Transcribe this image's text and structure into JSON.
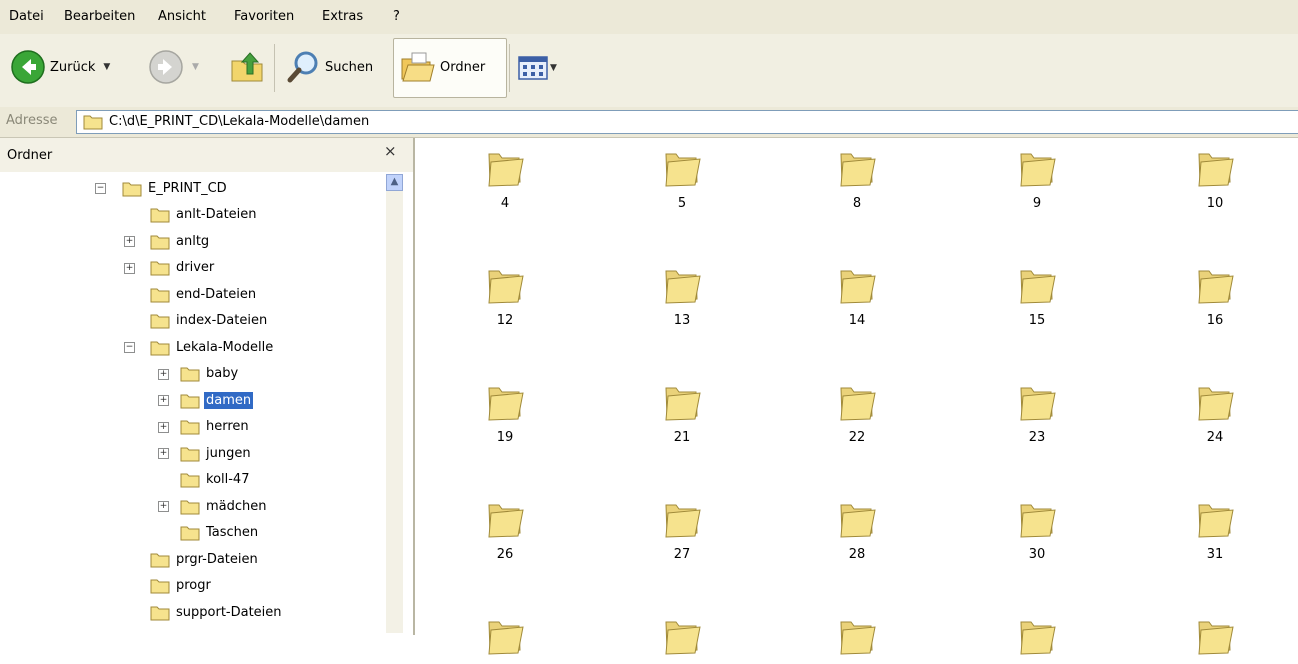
{
  "menu": [
    "Datei",
    "Bearbeiten",
    "Ansicht",
    "Favoriten",
    "Extras",
    "?"
  ],
  "toolbar": {
    "back_label": "Zurück",
    "search_label": "Suchen",
    "folders_label": "Ordner"
  },
  "address": {
    "label": "Adresse",
    "path": "C:\\d\\E_PRINT_CD\\Lekala-Modelle\\damen"
  },
  "folder_pane": {
    "title": "Ordner",
    "close": "×",
    "tree": [
      {
        "label": "E_PRINT_CD",
        "expander": "−",
        "level": 0
      },
      {
        "label": "anlt-Dateien",
        "expander": "",
        "level": 1
      },
      {
        "label": "anltg",
        "expander": "+",
        "level": 1
      },
      {
        "label": "driver",
        "expander": "+",
        "level": 1
      },
      {
        "label": "end-Dateien",
        "expander": "",
        "level": 1
      },
      {
        "label": "index-Dateien",
        "expander": "",
        "level": 1
      },
      {
        "label": "Lekala-Modelle",
        "expander": "−",
        "level": 1
      },
      {
        "label": "baby",
        "expander": "+",
        "level": 2
      },
      {
        "label": "damen",
        "expander": "+",
        "level": 2,
        "selected": true
      },
      {
        "label": "herren",
        "expander": "+",
        "level": 2
      },
      {
        "label": "jungen",
        "expander": "+",
        "level": 2
      },
      {
        "label": "koll-47",
        "expander": "",
        "level": 2
      },
      {
        "label": "mädchen",
        "expander": "+",
        "level": 2
      },
      {
        "label": "Taschen",
        "expander": "",
        "level": 2
      },
      {
        "label": "prgr-Dateien",
        "expander": "",
        "level": 1
      },
      {
        "label": "progr",
        "expander": "",
        "level": 1
      },
      {
        "label": "support-Dateien",
        "expander": "",
        "level": 1
      }
    ]
  },
  "folders": [
    "4",
    "5",
    "8",
    "9",
    "10",
    "12",
    "13",
    "14",
    "15",
    "16",
    "19",
    "21",
    "22",
    "23",
    "24",
    "26",
    "27",
    "28",
    "30",
    "31",
    "",
    "",
    "",
    "",
    ""
  ],
  "colors": {
    "folder_fill": "#f6e38e",
    "folder_stroke": "#a08a3a",
    "selection": "#316ac5"
  }
}
